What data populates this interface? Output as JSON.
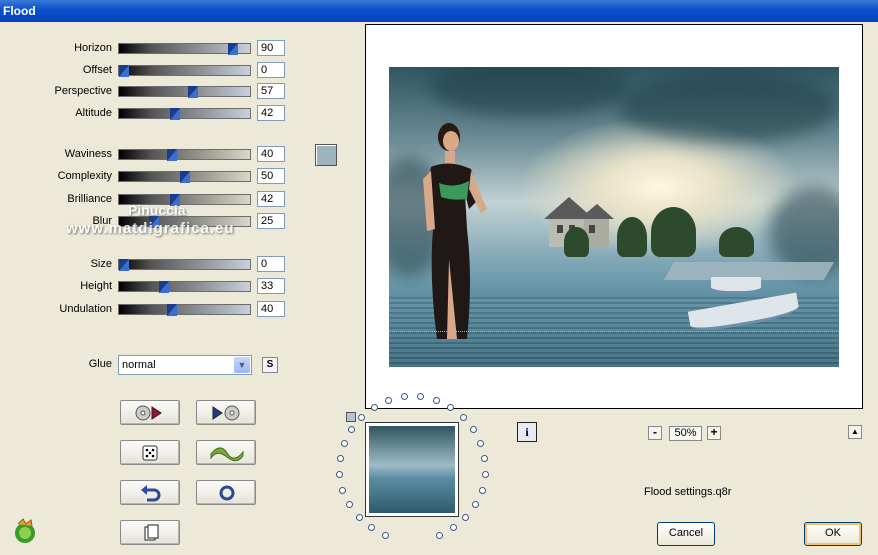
{
  "window": {
    "title": "Flood"
  },
  "sliders": [
    {
      "label": "Horizon",
      "value": "90",
      "position": 0.9
    },
    {
      "label": "Offset",
      "value": "0",
      "position": 0.0
    },
    {
      "label": "Perspective",
      "value": "57",
      "position": 0.57
    },
    {
      "label": "Altitude",
      "value": "42",
      "position": 0.42
    },
    {
      "label": "Waviness",
      "value": "40",
      "position": 0.4
    },
    {
      "label": "Complexity",
      "value": "50",
      "position": 0.5
    },
    {
      "label": "Brilliance",
      "value": "42",
      "position": 0.42
    },
    {
      "label": "Blur",
      "value": "25",
      "position": 0.25
    },
    {
      "label": "Size",
      "value": "0",
      "position": 0.0
    },
    {
      "label": "Height",
      "value": "33",
      "position": 0.33
    },
    {
      "label": "Undulation",
      "value": "40",
      "position": 0.4
    }
  ],
  "glue": {
    "label": "Glue",
    "value": "normal",
    "s_button": "S"
  },
  "watermark": {
    "line1": "Pinuccia",
    "line2": "www.matdigrafica.eu"
  },
  "zoom": {
    "value": "50%",
    "minus": "-",
    "plus": "+"
  },
  "settings_file": "Flood settings.q8r",
  "buttons": {
    "cancel": "Cancel",
    "ok": "OK"
  },
  "colors": {
    "swatch": "#9db4bd",
    "titlebar": "#0a4fc8"
  }
}
